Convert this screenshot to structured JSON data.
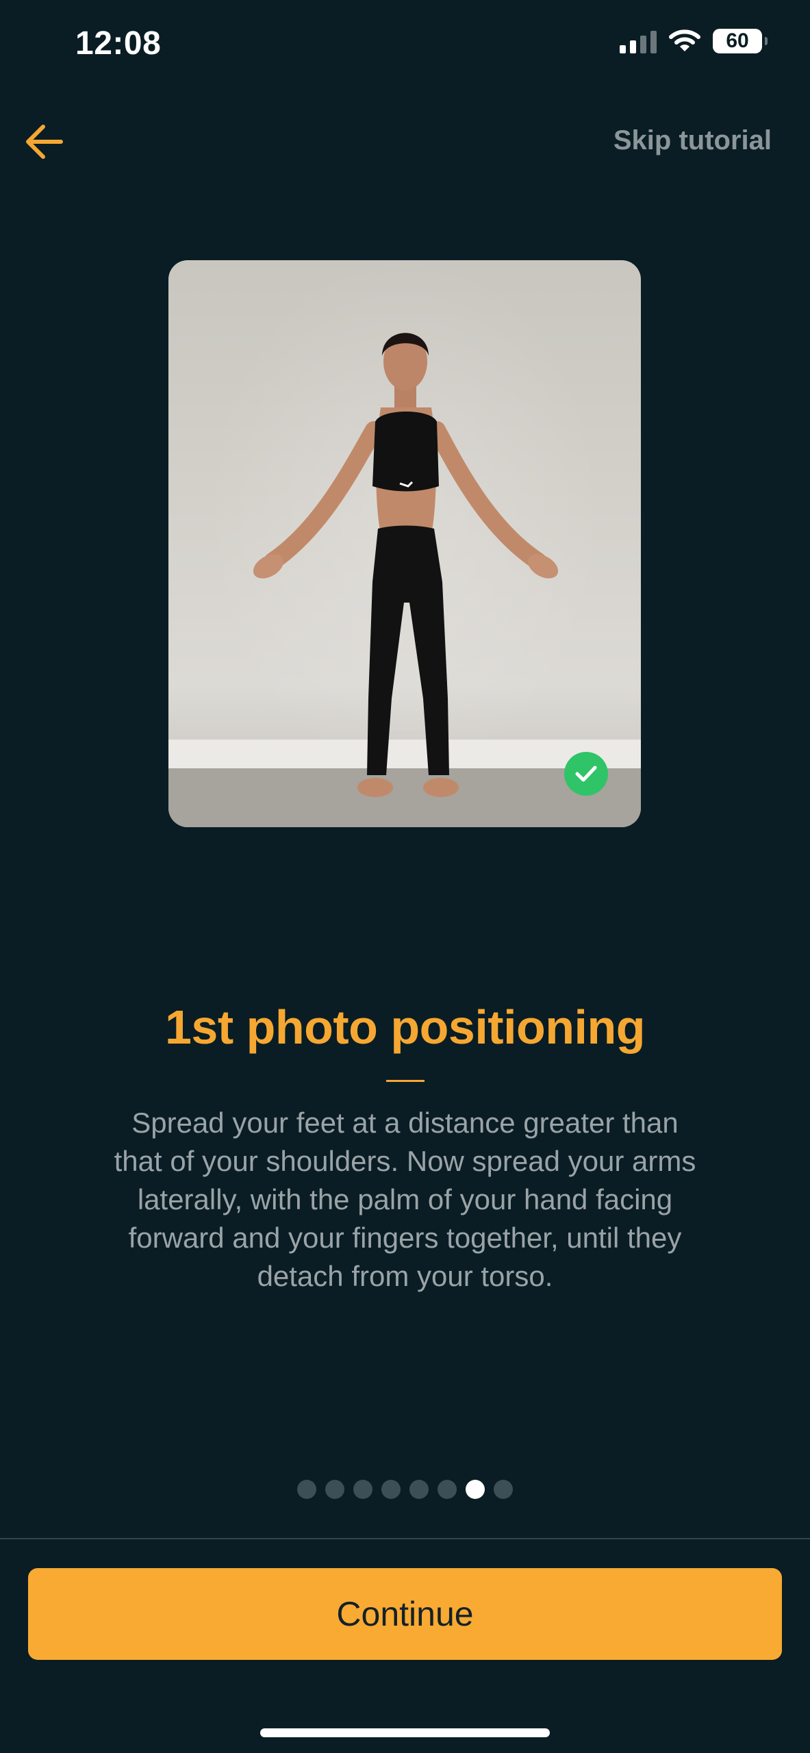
{
  "status_bar": {
    "time": "12:08",
    "battery": "60",
    "icons": [
      "cellular-signal-icon",
      "wifi-icon",
      "battery-icon"
    ]
  },
  "nav": {
    "back_icon": "arrow-left-icon",
    "skip_label": "Skip tutorial"
  },
  "photo": {
    "status_icon": "check-icon"
  },
  "content": {
    "title": "1st photo positioning",
    "description": "Spread your feet at a distance greater than that of your shoulders. Now spread your arms laterally, with the palm of your hand facing forward and your fingers together, until they detach from your torso."
  },
  "pager": {
    "total": 8,
    "active_index": 6
  },
  "footer": {
    "continue_label": "Continue"
  },
  "colors": {
    "background": "#0a1d24",
    "accent": "#f6a732",
    "button": "#f8aa33",
    "muted_text": "#9aa3a7",
    "success": "#2fc468"
  }
}
